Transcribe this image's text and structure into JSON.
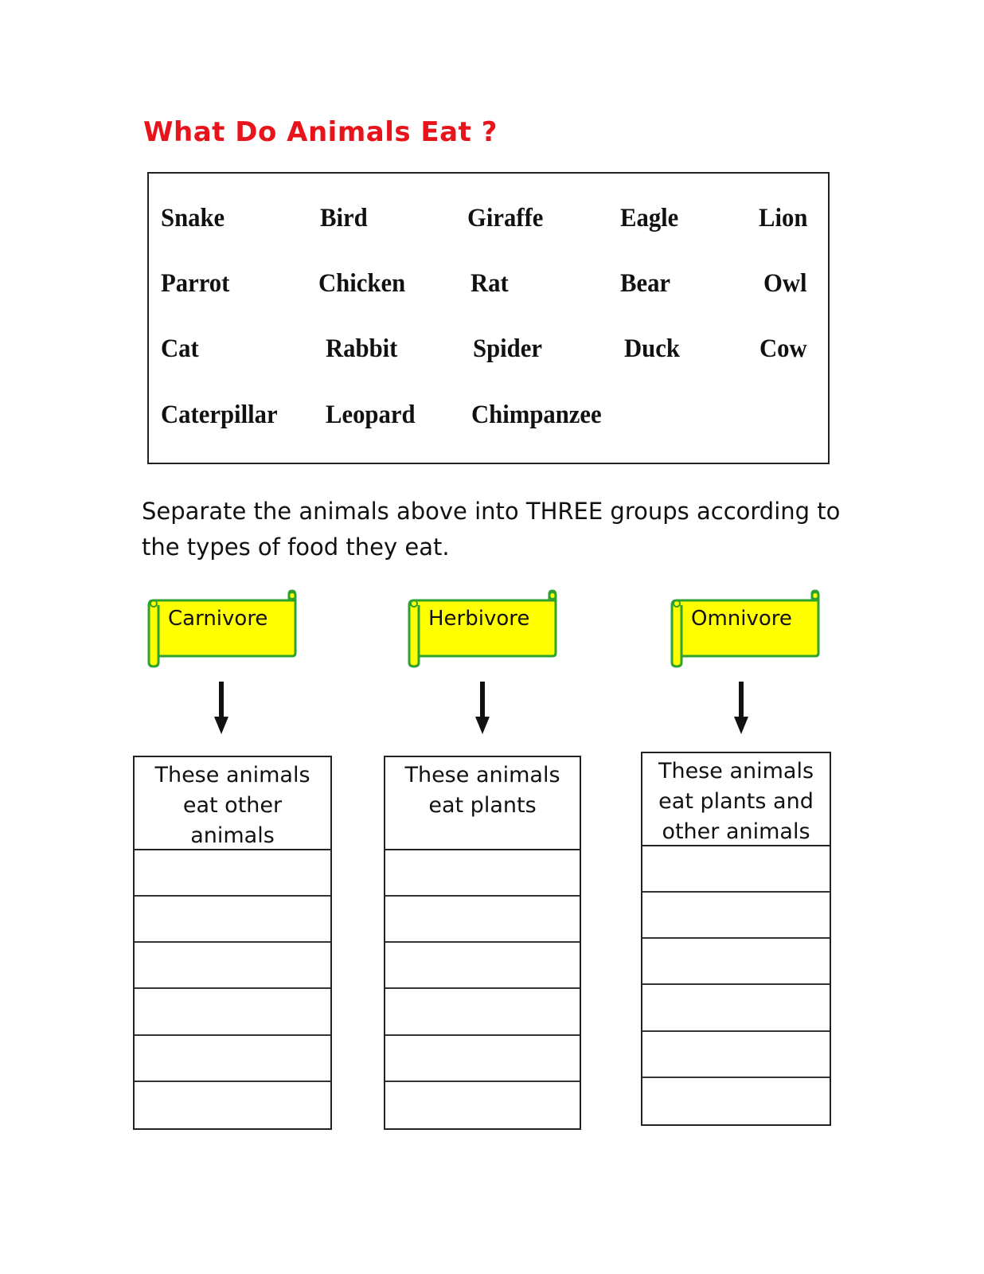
{
  "title": "What Do Animals Eat ?",
  "colors": {
    "title": "#e8141b",
    "scroll_fill": "#ffff00",
    "scroll_border": "#2ea12e",
    "ink": "#111111"
  },
  "animals": [
    [
      "Snake",
      "Bird",
      "Giraffe",
      "Eagle",
      "Lion"
    ],
    [
      "Parrot",
      "Chicken",
      "Rat",
      "Bear",
      "Owl"
    ],
    [
      "Cat",
      "Rabbit",
      "Spider",
      "Duck",
      "Cow"
    ],
    [
      "Caterpillar",
      "Leopard",
      "Chimpanzee"
    ]
  ],
  "instructions": "Separate the animals above into THREE groups according to the types of food they eat.",
  "groups": [
    {
      "label": "Carnivore",
      "description": "These animals eat other animals",
      "blank_rows": 6
    },
    {
      "label": "Herbivore",
      "description": "These animals eat plants",
      "blank_rows": 6
    },
    {
      "label": "Omnivore",
      "description": "These animals eat plants and other animals",
      "blank_rows": 6
    }
  ]
}
